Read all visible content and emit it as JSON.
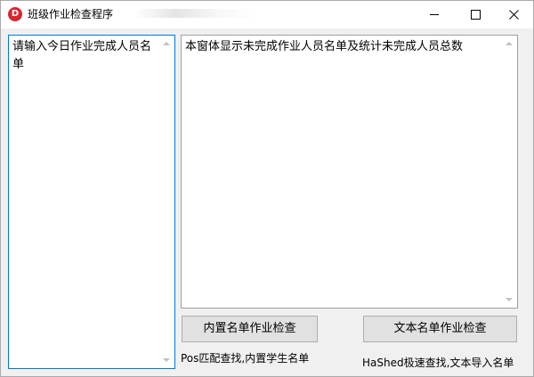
{
  "window": {
    "title": "班级作业检查程序",
    "icon_letter": "D",
    "accent_color": "#0078d7",
    "icon_color": "#d9262c"
  },
  "controls": {
    "minimize_icon": "minimize-icon",
    "maximize_icon": "maximize-icon",
    "close_icon": "close-icon"
  },
  "input_box": {
    "text": "请输入今日作业完成人员名单"
  },
  "output_box": {
    "text": "本窗体显示未完成作业人员名单及统计未完成人员总数"
  },
  "buttons": {
    "builtin_check": "内置名单作业检查",
    "text_check": "文本名单作业检查"
  },
  "labels": {
    "builtin_desc": "Pos匹配查找,内置学生名单",
    "text_desc": "HaShed极速查找,文本导入名单"
  }
}
